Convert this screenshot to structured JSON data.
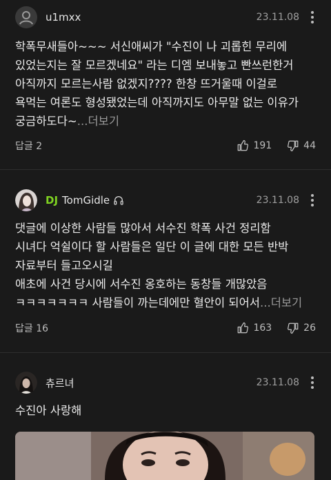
{
  "comments": [
    {
      "username": "u1mxx",
      "date": "23.11.08",
      "lines": [
        "학폭무새들아~~~ 서신애씨가 \"수진이 나 괴롭힌 무리에",
        "있었는지는 잘 모르겠네요\" 라는 디엠 보내놓고 빤쓰런한거",
        "아직까지 모르는사람 없겠지???? 한창 뜨거울때 이걸로",
        "욕먹는 여론도 형성됐었는데 아직까지도 아무말 없는 이유가",
        "궁금하도다~"
      ],
      "more": "...더보기",
      "reply": "답글 2",
      "likes": "191",
      "dislikes": "44"
    },
    {
      "badge": "DJ",
      "username": "TomGidle",
      "date": "23.11.08",
      "lines": [
        "댓글에 이상한 사람들 많아서 서수진 학폭 사건 정리함",
        "시녀다 억쉴이다 할 사람들은 일단 이 글에 대한 모든 반박",
        "자료부터 들고오시길",
        "애초에 사건 당시에 서수진 옹호하는 동창들 개많았음",
        "ㅋㅋㅋㅋㅋㅋㅋ 사람들이 까는데에만 혈안이 되어서"
      ],
      "more": "...더보기",
      "reply": "답글 16",
      "likes": "163",
      "dislikes": "26"
    },
    {
      "username": "츄르녀",
      "date": "23.11.08",
      "lines": [
        "수진아 사랑해"
      ]
    }
  ]
}
